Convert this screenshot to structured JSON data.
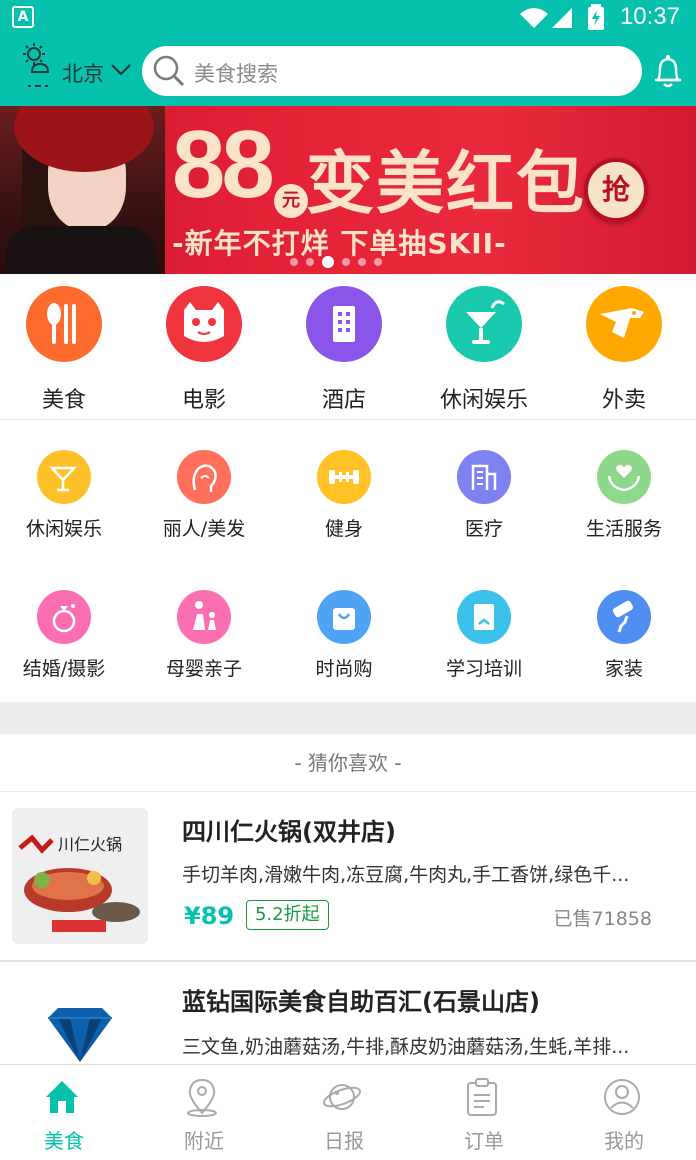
{
  "status_bar": {
    "time": "10:37",
    "app_badge": "A"
  },
  "header": {
    "city": "北京",
    "search_placeholder": "美食搜索",
    "icons": [
      "weather-icon",
      "chevron-down-icon",
      "search-icon",
      "bell-icon"
    ]
  },
  "banner": {
    "amount": "88",
    "unit": "元",
    "title": "变美红包",
    "subtitle": "-新年不打烊 下单抽SKII-",
    "button": "抢",
    "page_count": 6,
    "active_page": 3
  },
  "main_categories": [
    {
      "label": "美食",
      "icon": "fork-knife-icon",
      "color": "#ff6b2e"
    },
    {
      "label": "电影",
      "icon": "cat-icon",
      "color": "#f0353f"
    },
    {
      "label": "酒店",
      "icon": "building-icon",
      "color": "#8a55e8"
    },
    {
      "label": "休闲娱乐",
      "icon": "cocktail-icon",
      "color": "#18c9ad"
    },
    {
      "label": "外卖",
      "icon": "kangaroo-icon",
      "color": "#ffa800"
    }
  ],
  "sub_categories": [
    {
      "label": "休闲娱乐",
      "icon": "cocktail-icon",
      "color": "#fdc12a"
    },
    {
      "label": "丽人/美发",
      "icon": "woman-profile-icon",
      "color": "#ff6f5b"
    },
    {
      "label": "健身",
      "icon": "dumbbell-icon",
      "color": "#ffc328"
    },
    {
      "label": "医疗",
      "icon": "hospital-icon",
      "color": "#7f83f2"
    },
    {
      "label": "生活服务",
      "icon": "heart-hand-icon",
      "color": "#8ed88a"
    },
    {
      "label": "结婚/摄影",
      "icon": "ring-icon",
      "color": "#fb6fb2"
    },
    {
      "label": "母婴亲子",
      "icon": "parent-child-icon",
      "color": "#fb6fb2"
    },
    {
      "label": "时尚购",
      "icon": "shopping-bag-icon",
      "color": "#4ea3f5"
    },
    {
      "label": "学习培训",
      "icon": "book-icon",
      "color": "#3bc1ea"
    },
    {
      "label": "家装",
      "icon": "paint-roller-icon",
      "color": "#4f8ff2"
    }
  ],
  "section_title": "- 猜你喜欢 -",
  "listings": [
    {
      "name": "四川仁火锅(双井店)",
      "description": "手切羊肉,滑嫩牛肉,冻豆腐,牛肉丸,手工香饼,绿色千...",
      "price": "¥89",
      "discount": "5.2折起",
      "sold": "已售71858"
    },
    {
      "name": "蓝钻国际美食自助百汇(石景山店)",
      "description": "三文鱼,奶油蘑菇汤,牛排,酥皮奶油蘑菇汤,生蚝,羊排..."
    }
  ],
  "tabs": [
    {
      "label": "美食",
      "icon": "home-icon",
      "active": true
    },
    {
      "label": "附近",
      "icon": "location-pin-icon",
      "active": false
    },
    {
      "label": "日报",
      "icon": "planet-icon",
      "active": false
    },
    {
      "label": "订单",
      "icon": "clipboard-icon",
      "active": false
    },
    {
      "label": "我的",
      "icon": "user-icon",
      "active": false
    }
  ],
  "colors": {
    "primary": "#06c1ae",
    "banner_red": "#e32136",
    "discount_green": "#1a9a3a"
  }
}
